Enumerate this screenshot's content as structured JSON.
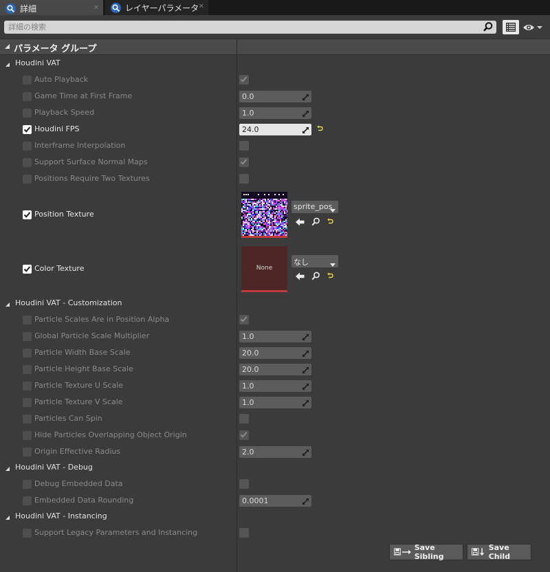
{
  "tabs": [
    {
      "label": "詳細",
      "active": true
    },
    {
      "label": "レイヤーパラメータ",
      "active": false
    }
  ],
  "search": {
    "placeholder": "詳細の検索",
    "value": ""
  },
  "category": {
    "title": "パラメータ グループ"
  },
  "groups": [
    {
      "title": "Houdini VAT"
    },
    {
      "title": "Houdini VAT - Customization"
    },
    {
      "title": "Houdini VAT - Debug"
    },
    {
      "title": "Houdini VAT - Instancing"
    }
  ],
  "properties": [
    {
      "label": "Auto Playback",
      "enabled": false,
      "kind": "bool",
      "checked": true
    },
    {
      "label": "Game Time at First Frame",
      "enabled": false,
      "kind": "number",
      "value": "0.0"
    },
    {
      "label": "Playback Speed",
      "enabled": false,
      "kind": "number",
      "value": "1.0"
    },
    {
      "label": "Houdini FPS",
      "enabled": true,
      "kind": "number",
      "value": "24.0"
    },
    {
      "label": "Interframe Interpolation",
      "enabled": false,
      "kind": "bool",
      "checked": false
    },
    {
      "label": "Support Surface Normal Maps",
      "enabled": false,
      "kind": "bool",
      "checked": true
    },
    {
      "label": "Positions Require Two Textures",
      "enabled": false,
      "kind": "bool",
      "checked": false
    },
    {
      "label": "Position Texture",
      "enabled": true,
      "kind": "texture",
      "asset": "sprite_pos"
    },
    {
      "label": "Color Texture",
      "enabled": true,
      "kind": "texture",
      "asset": "なし",
      "thumb_text": "None"
    },
    {
      "label": "Particle Scales Are in Position Alpha",
      "enabled": false,
      "kind": "bool",
      "checked": true
    },
    {
      "label": "Global Particle Scale Multiplier",
      "enabled": false,
      "kind": "number",
      "value": "1.0"
    },
    {
      "label": "Particle Width Base Scale",
      "enabled": false,
      "kind": "number",
      "value": "20.0"
    },
    {
      "label": "Particle Height Base Scale",
      "enabled": false,
      "kind": "number",
      "value": "20.0"
    },
    {
      "label": "Particle Texture U Scale",
      "enabled": false,
      "kind": "number",
      "value": "1.0"
    },
    {
      "label": "Particle Texture V Scale",
      "enabled": false,
      "kind": "number",
      "value": "1.0"
    },
    {
      "label": "Particles Can Spin",
      "enabled": false,
      "kind": "bool",
      "checked": false
    },
    {
      "label": "Hide Particles Overlapping Object Origin",
      "enabled": false,
      "kind": "bool",
      "checked": true
    },
    {
      "label": "Origin Effective Radius",
      "enabled": false,
      "kind": "number",
      "value": "2.0"
    },
    {
      "label": "Debug Embedded Data",
      "enabled": false,
      "kind": "bool",
      "checked": false
    },
    {
      "label": "Embedded Data Rounding",
      "enabled": false,
      "kind": "number",
      "value": "0.0001"
    },
    {
      "label": "Support Legacy Parameters and Instancing",
      "enabled": false,
      "kind": "bool",
      "checked": false
    }
  ],
  "buttons": {
    "save_sibling": "Save Sibling",
    "save_child": "Save Child"
  }
}
